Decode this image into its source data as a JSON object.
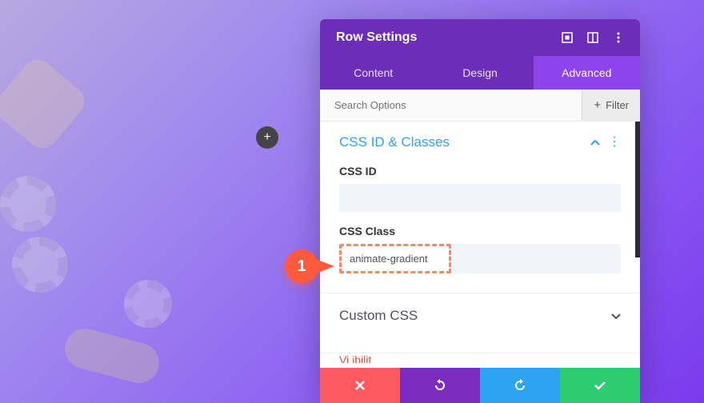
{
  "header": {
    "title": "Row Settings"
  },
  "tabs": [
    {
      "label": "Content",
      "active": false
    },
    {
      "label": "Design",
      "active": false
    },
    {
      "label": "Advanced",
      "active": true
    }
  ],
  "search": {
    "placeholder": "Search Options"
  },
  "filter": {
    "label": "Filter"
  },
  "sections": {
    "css_id_classes": {
      "title": "CSS ID & Classes",
      "fields": {
        "css_id": {
          "label": "CSS ID",
          "value": ""
        },
        "css_class": {
          "label": "CSS Class",
          "value": "animate-gradient"
        }
      }
    },
    "custom_css": {
      "title": "Custom CSS"
    }
  },
  "callout": {
    "number": "1"
  }
}
